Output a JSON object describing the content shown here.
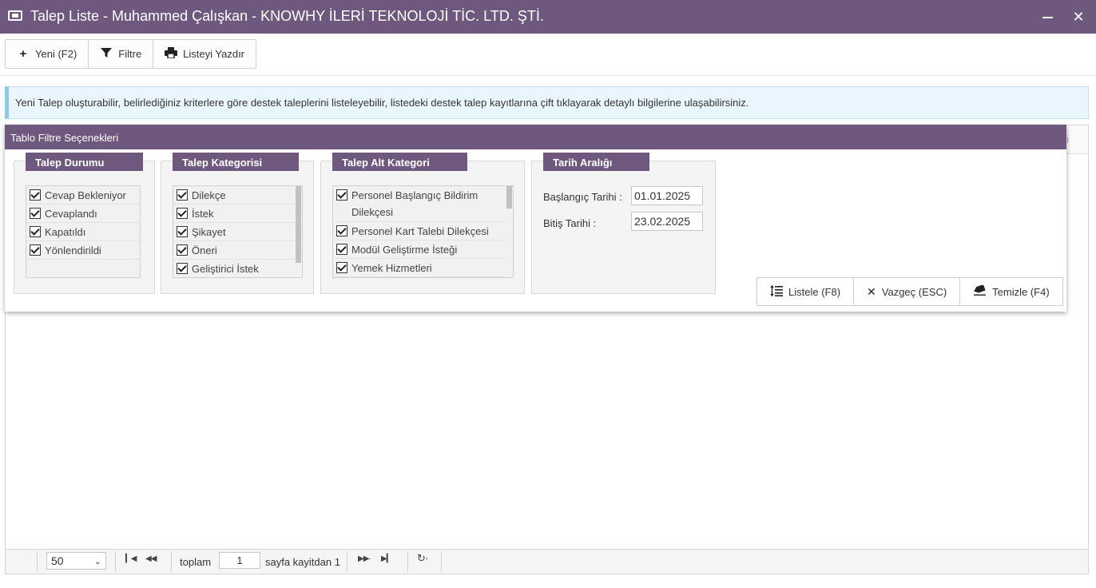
{
  "window": {
    "title": "Talep Liste - Muhammed Çalışkan - KNOWHY İLERİ TEKNOLOJİ TİC. LTD. ŞTİ.",
    "app_icon": "ticket-icon",
    "accent": "#6e587e"
  },
  "toolbar": {
    "new_label": "Yeni (F2)",
    "filter_label": "Filtre",
    "print_label": "Listeyi Yazdır"
  },
  "info": {
    "text": "Yeni Talep oluşturabilir, belirlediğiniz kriterlere göre destek taleplerini listeleyebilir, listedeki destek talep kayıtlarına çift tıklayarak detaylı bilgilerine ulaşabilirsiniz."
  },
  "filter_panel": {
    "title": "Tablo Filtre Seçenekleri",
    "status_group": {
      "title": "Talep Durumu",
      "items": [
        "Cevap Bekleniyor",
        "Cevaplandı",
        "Kapatıldı",
        "Yönlendirildi"
      ]
    },
    "category_group": {
      "title": "Talep Kategorisi",
      "items": [
        "Dilekçe",
        "İstek",
        "Şikayet",
        "Öneri",
        "Geliştirici İstek"
      ]
    },
    "subcategory_group": {
      "title": "Talep Alt Kategori",
      "items": [
        "Personel Başlangıç Bildirim Dilekçesi",
        "Personel Kart Talebi Dilekçesi",
        "Modül Geliştirme İsteği",
        "Yemek Hizmetleri"
      ]
    },
    "date_group": {
      "title": "Tarih Aralığı",
      "start_label": "Başlangıç Tarihi :",
      "start_value": "01.01.2025",
      "end_label": "Bitiş Tarihi :",
      "end_value": "23.02.2025"
    },
    "actions": {
      "list_label": "Listele (F8)",
      "cancel_label": "Vazgeç (ESC)",
      "clear_label": "Temizle (F4)"
    }
  },
  "pager": {
    "page_size": "50",
    "total_label": "toplam",
    "page_value": "1",
    "of_label": "sayfa kayitdan 1"
  }
}
